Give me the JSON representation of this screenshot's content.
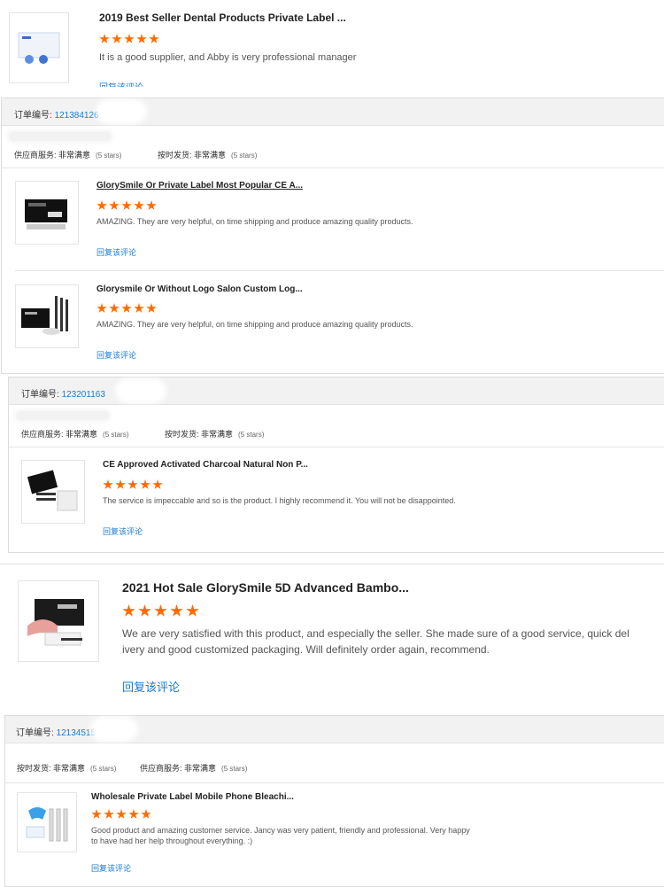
{
  "reviews_top": {
    "title": "2019 Best Seller Dental Products Private Label ...",
    "text": "It is a good supplier, and Abby is very professional manager",
    "reply": "回复该评论"
  },
  "order1": {
    "order_label": "订单编号:",
    "order_number": "121384126",
    "service_label": "供应商服务:",
    "service_value": "非常满意",
    "service_stars": "(5 stars)",
    "shipping_label": "按时发货:",
    "shipping_value": "非常满意",
    "shipping_stars": "(5 stars)",
    "items": [
      {
        "title": "GlorySmile Or Private Label Most Popular CE A...",
        "text": "AMAZING. They are very helpful, on time shipping and produce amazing quality products.",
        "reply": "回复该评论"
      },
      {
        "title": "Glorysmile Or Without Logo Salon Custom Log...",
        "text": "AMAZING. They are very helpful, on time shipping and produce amazing quality products.",
        "reply": "回复该评论"
      }
    ]
  },
  "order2": {
    "order_label": "订单编号:",
    "order_number": "123201163",
    "service_label": "供应商服务:",
    "service_value": "非常满意",
    "service_stars": "(5 stars)",
    "shipping_label": "按时发货:",
    "shipping_value": "非常满意",
    "shipping_stars": "(5 stars)",
    "item": {
      "title": "CE Approved Activated Charcoal Natural Non P...",
      "text": "The service is impeccable and so is the product. I highly recommend it. You will not be disappointed.",
      "reply": "回复该评论"
    }
  },
  "review_large": {
    "title": "2021 Hot Sale GlorySmile 5D Advanced Bambo...",
    "text_line1": "We are very satisfied with this product, and especially the seller. She made sure of a good service, quick del",
    "text_line2": "ivery and good customized packaging. Will definitely order again, recommend.",
    "reply": "回复该评论"
  },
  "order3": {
    "order_label": "订单编号:",
    "order_number": "121345151",
    "shipping_label": "按时发货:",
    "shipping_value": "非常满意",
    "shipping_stars": "(5 stars)",
    "service_label": "供应商服务:",
    "service_value": "非常满意",
    "service_stars": "(5 stars)",
    "item": {
      "title": "Wholesale Private Label Mobile Phone Bleachi...",
      "text_line1": "Good product and amazing customer service. Jancy was very patient, friendly and professional. Very happy",
      "text_line2": "to have had her help throughout everything. :)",
      "reply": "回复该评论"
    }
  },
  "colors": {
    "star": "#ff6a00",
    "link": "#1a7ad4",
    "header_bg": "#f2f2f2"
  }
}
